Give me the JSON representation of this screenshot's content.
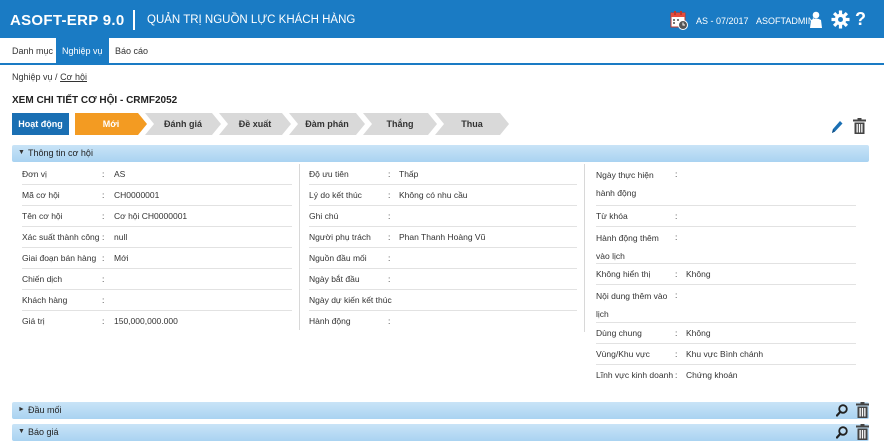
{
  "header": {
    "logo": "ASOFT-ERP 9.0",
    "app_title": "QUẢN TRỊ NGUỒN LỰC KHÁCH HÀNG",
    "period": "AS - 07/2017",
    "user": "ASOFTADMIN",
    "help": "?",
    "colors": {
      "bar": "#1a7bc4"
    }
  },
  "menu": [
    {
      "label": "Danh mục",
      "active": false
    },
    {
      "label": "Nghiệp vụ",
      "active": true
    },
    {
      "label": "Báo cáo",
      "active": false
    }
  ],
  "breadcrumb": {
    "root": "Nghiệp vụ",
    "separator": "/ ",
    "current": "Cơ hội"
  },
  "page_title": "XEM CHI TIẾT CƠ HỘI - CRMF2052",
  "stage_bar": {
    "label": "Hoạt động",
    "stages": [
      {
        "label": "Mới",
        "active": true
      },
      {
        "label": "Đánh giá",
        "active": false
      },
      {
        "label": "Đề xuất",
        "active": false
      },
      {
        "label": "Đàm phán",
        "active": false
      },
      {
        "label": "Thắng",
        "active": false
      },
      {
        "label": "Thua",
        "active": false
      }
    ],
    "active_color": "#f39b22"
  },
  "panels": {
    "info": {
      "title": "Thông tin cơ hội",
      "expanded": true
    },
    "leads": {
      "title": "Đầu mối",
      "expanded": false
    },
    "quotes": {
      "title": "Báo giá",
      "expanded": false
    }
  },
  "info": {
    "col1": [
      {
        "label": "Đơn vị",
        "value": "AS"
      },
      {
        "label": "Mã cơ hội",
        "value": "CH0000001"
      },
      {
        "label": "Tên cơ hội",
        "value": "Cơ hội CH0000001"
      },
      {
        "label": "Xác suất thành công",
        "value": "null"
      },
      {
        "label": "Giai đoạn bán hàng",
        "value": "Mới"
      },
      {
        "label": "Chiến dịch",
        "value": ""
      },
      {
        "label": "Khách hàng",
        "value": ""
      },
      {
        "label": "Giá trị",
        "value": "150,000,000.000"
      }
    ],
    "col2": [
      {
        "label": "Độ ưu tiên",
        "value": "Thấp"
      },
      {
        "label": "Lý do kết thúc",
        "value": "Không có nhu cầu"
      },
      {
        "label": "Ghi chú",
        "value": ""
      },
      {
        "label": "Người phụ trách",
        "value": "Phan Thanh Hoàng Vũ"
      },
      {
        "label": "Nguồn đầu mối",
        "value": ""
      },
      {
        "label": "Ngày bắt đầu",
        "value": ""
      },
      {
        "label": "Ngày dự kiến kết thúc",
        "value": ""
      },
      {
        "label": "Hành động",
        "value": ""
      }
    ],
    "col3": [
      {
        "label": "Ngày thực hiện hành động",
        "value": ""
      },
      {
        "label": "Từ khóa",
        "value": ""
      },
      {
        "label": "Hành động thêm vào lịch",
        "value": ""
      },
      {
        "label": "Không hiển thị",
        "value": "Không"
      },
      {
        "label": "Nội dung thêm vào lịch",
        "value": ""
      },
      {
        "label": "Dùng chung",
        "value": "Không"
      },
      {
        "label": "Vùng/Khu vực",
        "value": "Khu vực Bình chánh"
      },
      {
        "label": "Lĩnh vực kinh doanh",
        "value": "Chứng khoán"
      }
    ]
  }
}
